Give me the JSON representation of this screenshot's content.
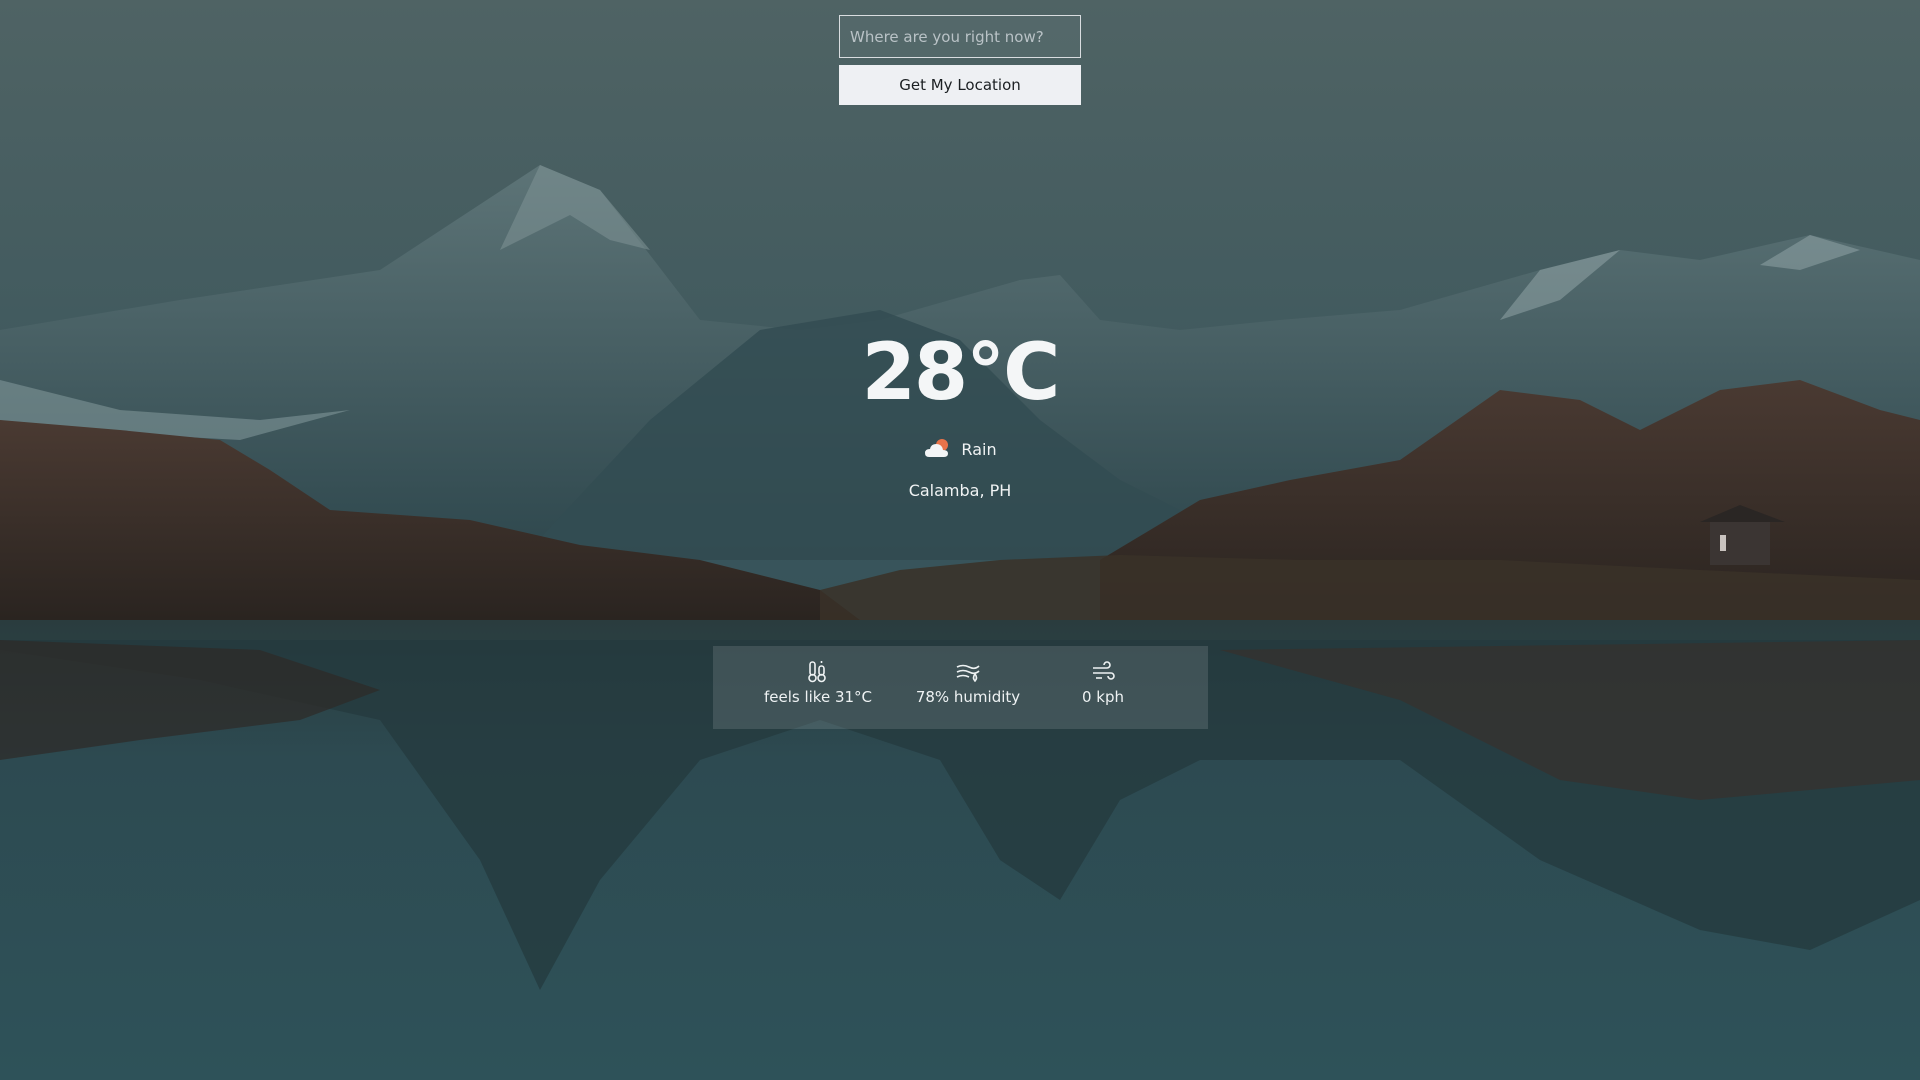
{
  "search": {
    "placeholder": "Where are you right now?",
    "value": ""
  },
  "locate_button": {
    "label": "Get My Location"
  },
  "weather": {
    "temperature": "28°C",
    "condition": "Rain",
    "condition_icon": "cloud-sun-icon",
    "location": "Calamba, PH"
  },
  "details": {
    "feels_like": {
      "label": "feels like 31°C",
      "icon": "thermometer-icon"
    },
    "humidity": {
      "label": "78% humidity",
      "icon": "humidity-wind-icon"
    },
    "wind": {
      "label": "0 kph",
      "icon": "wind-icon"
    }
  },
  "colors": {
    "text": "#f0f3f4",
    "button_bg": "#eef0f3",
    "panel_bg": "rgba(255,255,255,0.12)",
    "sun_accent": "#e8734a"
  }
}
